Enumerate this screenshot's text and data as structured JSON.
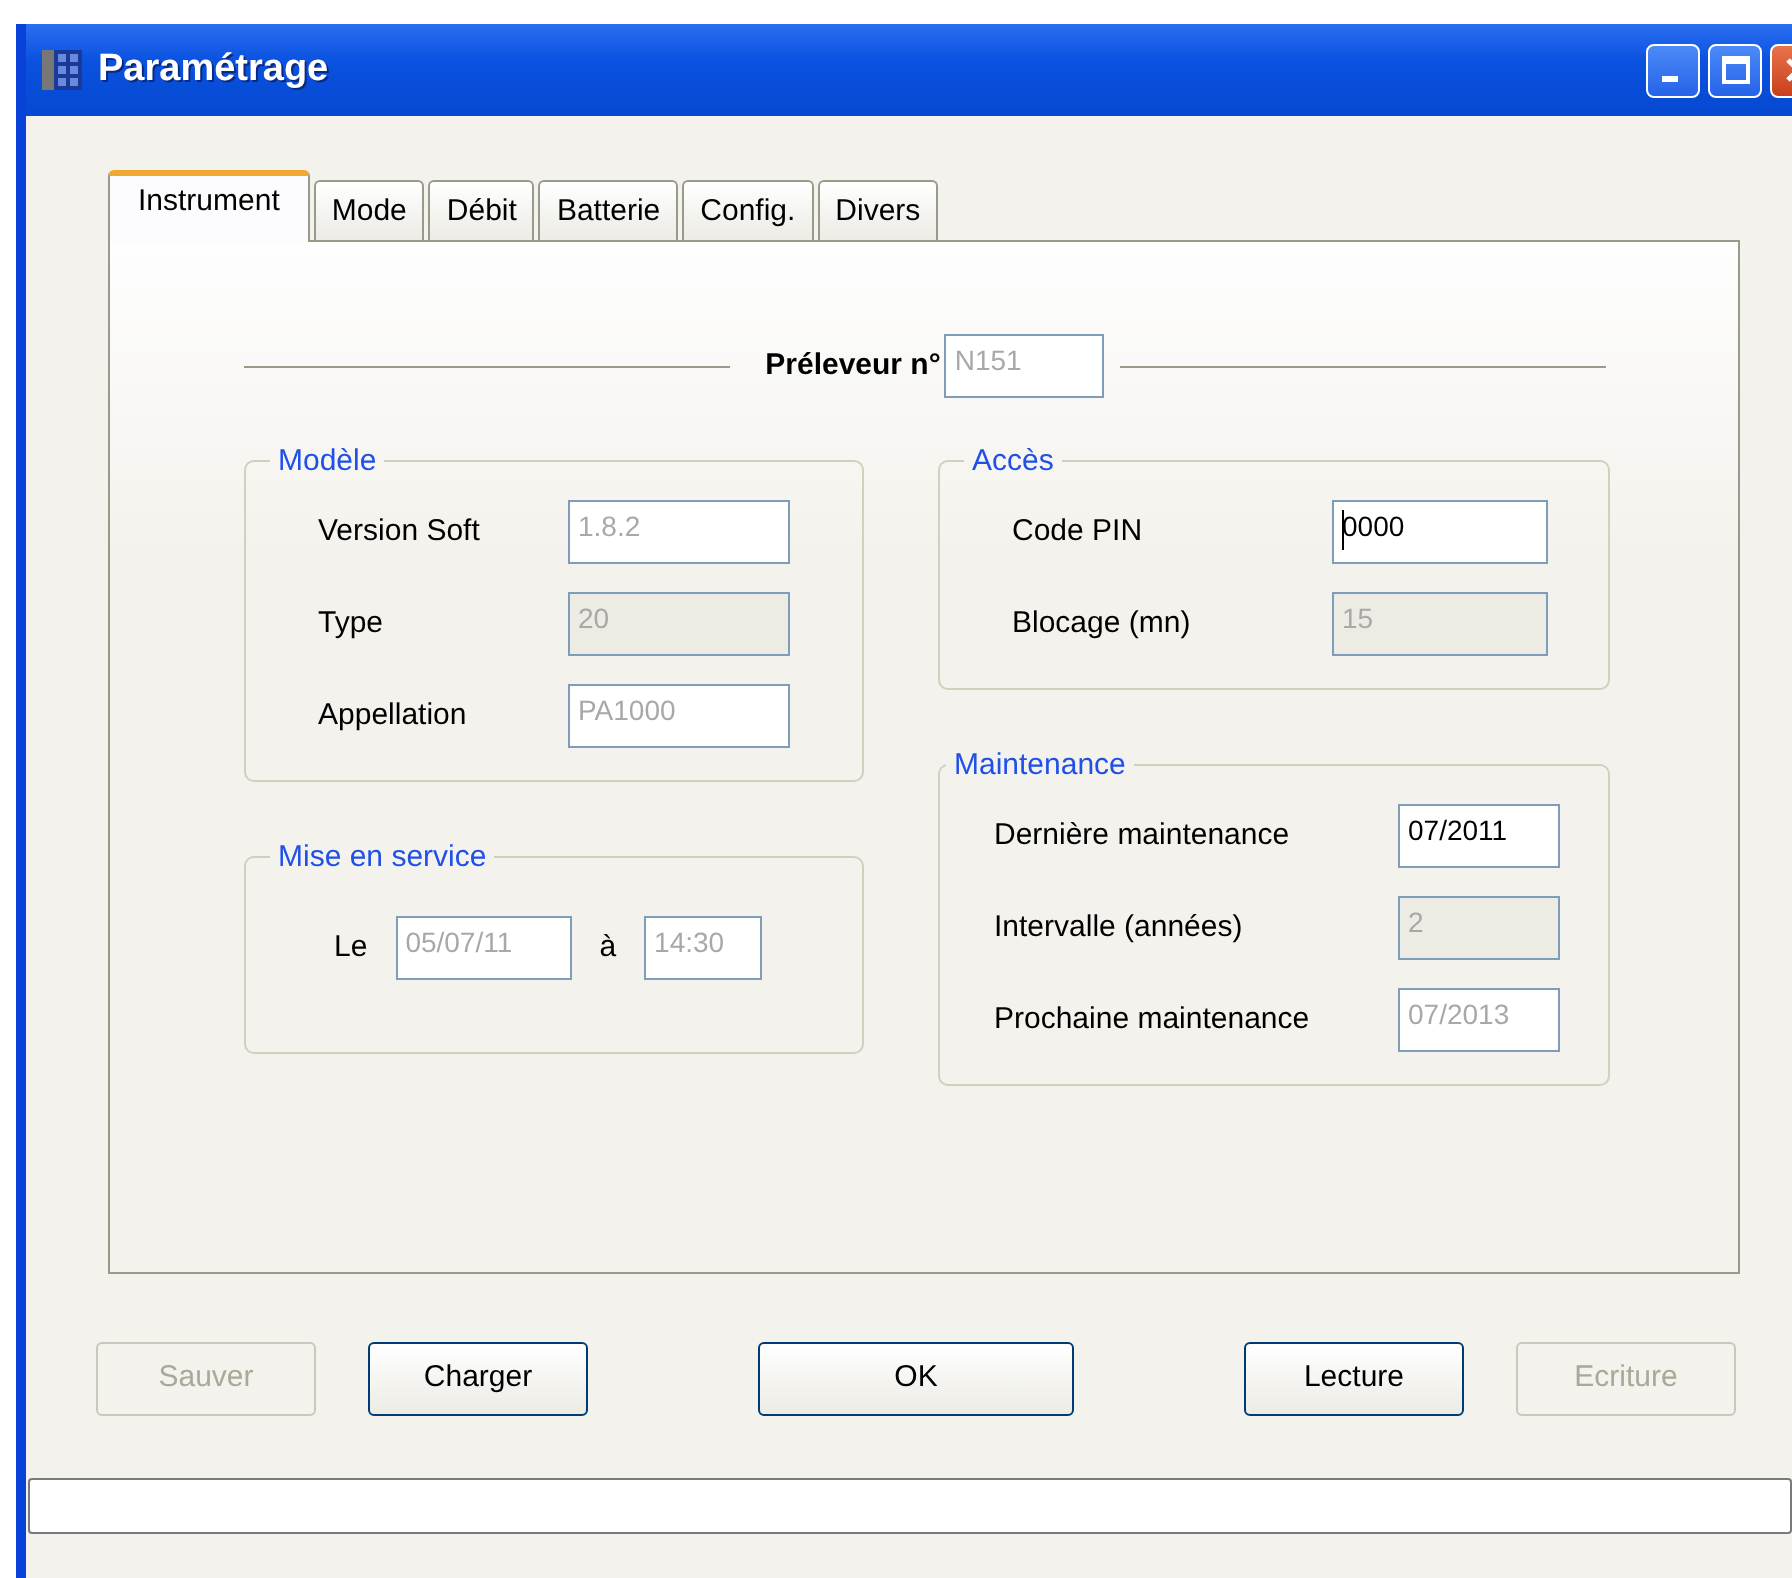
{
  "window": {
    "title": "Paramétrage"
  },
  "tabs": [
    {
      "label": "Instrument",
      "selected": true
    },
    {
      "label": "Mode",
      "selected": false
    },
    {
      "label": "Débit",
      "selected": false
    },
    {
      "label": "Batterie",
      "selected": false
    },
    {
      "label": "Config.",
      "selected": false
    },
    {
      "label": "Divers",
      "selected": false
    }
  ],
  "header": {
    "label": "Préleveur n°",
    "field": {
      "value": "N151",
      "readonly": true,
      "disabled": false
    }
  },
  "columns": [
    [
      {
        "title": "Modèle",
        "kind": "form",
        "rows": [
          {
            "label": "Version Soft",
            "field": {
              "value": "1.8.2",
              "readonly": true,
              "disabled": false
            }
          },
          {
            "label": "Type",
            "field": {
              "value": "20",
              "disabled": true
            }
          },
          {
            "label": "Appellation",
            "field": {
              "value": "PA1000",
              "readonly": true,
              "disabled": false
            }
          }
        ]
      },
      {
        "title": "Mise en service",
        "kind": "inline",
        "parts": [
          {
            "kind": "label",
            "text": "Le"
          },
          {
            "kind": "field",
            "value": "05/07/11",
            "readonly": true,
            "disabled": false
          },
          {
            "kind": "label",
            "text": "à"
          },
          {
            "kind": "field",
            "value": "14:30",
            "readonly": true,
            "disabled": false
          }
        ]
      }
    ],
    [
      {
        "title": "Accès",
        "kind": "form",
        "rows": [
          {
            "label": "Code PIN",
            "field": {
              "value": "0000",
              "readonly": false,
              "disabled": false,
              "focused": true
            }
          },
          {
            "label": "Blocage (mn)",
            "field": {
              "value": "15",
              "disabled": true
            }
          }
        ]
      },
      {
        "title": "Maintenance",
        "kind": "form",
        "rows": [
          {
            "label": "Dernière maintenance",
            "field": {
              "value": "07/2011",
              "readonly": false,
              "disabled": false
            }
          },
          {
            "label": "Intervalle (années)",
            "field": {
              "value": "2",
              "disabled": true
            }
          },
          {
            "label": "Prochaine maintenance",
            "field": {
              "value": "07/2013",
              "readonly": true,
              "disabled": false
            }
          }
        ]
      }
    ]
  ],
  "buttons": [
    {
      "label": "Sauver",
      "disabled": true
    },
    {
      "label": "Charger",
      "disabled": false
    },
    {
      "label": "OK",
      "disabled": false
    },
    {
      "label": "Lecture",
      "disabled": false
    },
    {
      "label": "Ecriture",
      "disabled": true
    }
  ]
}
